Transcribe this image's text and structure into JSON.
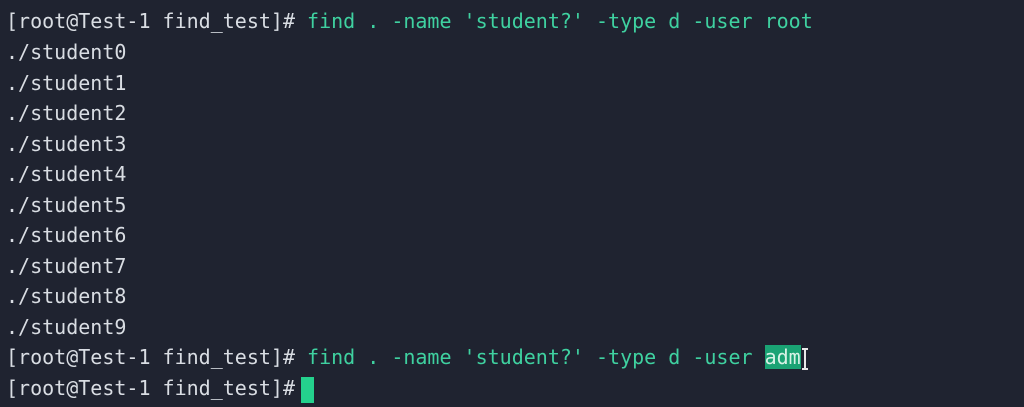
{
  "terminal": {
    "prompt": "[root@Test-1 find_test]#",
    "command1": " find . -name 'student?' -type d -user root",
    "output": [
      "./student0",
      "./student1",
      "./student2",
      "./student3",
      "./student4",
      "./student5",
      "./student6",
      "./student7",
      "./student8",
      "./student9"
    ],
    "command2_prefix": " find . -name 'student?' -type d -user ",
    "command2_selected": "adm",
    "colors": {
      "background": "#1f2330",
      "command_text": "#3fd1a0",
      "selection": "#1aa374",
      "cursor": "#24d18d"
    }
  }
}
